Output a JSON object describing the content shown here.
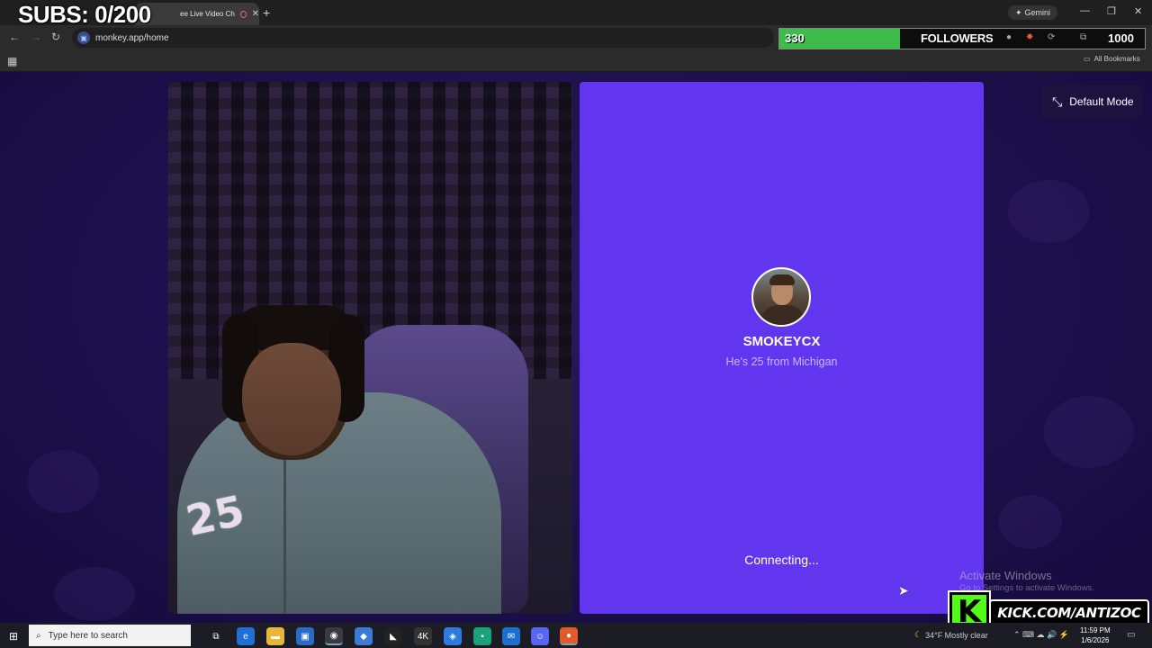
{
  "browser": {
    "tab_title": "ee Live Video Ch",
    "new_tab_glyph": "+",
    "url": "monkey.app/home",
    "gemini_label": "Gemini",
    "all_bookmarks": "All Bookmarks"
  },
  "overlay": {
    "subs_counter": "SUBS: 0/200",
    "followers_count": "330",
    "followers_label": "FOLLOWERS",
    "followers_goal": "1000",
    "followers_progress": 0.33,
    "kick_url": "KICK.COM/ANTIZOC",
    "kick_logo_letter": "K"
  },
  "page": {
    "mode_button": "Default Mode",
    "match": {
      "username": "SMOKEYCX",
      "info": "He's 25 from Michigan",
      "status": "Connecting..."
    },
    "jersey_number": "25"
  },
  "watermark": {
    "line1": "Activate Windows",
    "line2": "Go to Settings to activate Windows."
  },
  "taskbar": {
    "search_placeholder": "Type here to search",
    "weather": "34°F  Mostly clear",
    "time": "11:59 PM",
    "date": "1/6/2026"
  },
  "colors": {
    "panel": "#6236ee",
    "background": "#1e1250",
    "progress": "#3dbb4b",
    "kick_green": "#53fc18"
  }
}
